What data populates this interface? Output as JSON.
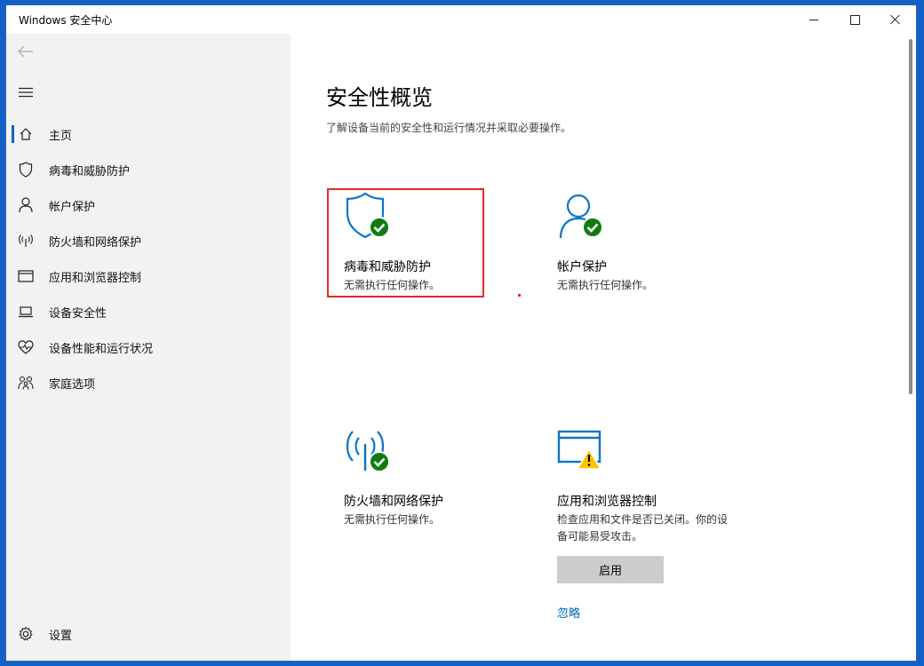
{
  "window": {
    "title": "Windows 安全中心"
  },
  "sidebar": {
    "items": [
      {
        "label": "主页",
        "icon": "home-icon",
        "selected": true
      },
      {
        "label": "病毒和威胁防护",
        "icon": "shield-icon"
      },
      {
        "label": "帐户保护",
        "icon": "person-icon"
      },
      {
        "label": "防火墙和网络保护",
        "icon": "wifi-antenna-icon"
      },
      {
        "label": "应用和浏览器控制",
        "icon": "app-window-icon"
      },
      {
        "label": "设备安全性",
        "icon": "laptop-icon"
      },
      {
        "label": "设备性能和运行状况",
        "icon": "heart-pulse-icon"
      },
      {
        "label": "家庭选项",
        "icon": "family-icon"
      }
    ],
    "settings_label": "设置"
  },
  "main": {
    "title": "安全性概览",
    "subtitle": "了解设备当前的安全性和运行情况并采取必要操作。",
    "cards": [
      {
        "title": "病毒和威胁防护",
        "status": "无需执行任何操作。",
        "icon": "shield-check-icon"
      },
      {
        "title": "帐户保护",
        "status": "无需执行任何操作。",
        "icon": "person-check-icon"
      },
      {
        "title": "防火墙和网络保护",
        "status": "无需执行任何操作。",
        "icon": "antenna-check-icon"
      },
      {
        "title": "应用和浏览器控制",
        "status": "检查应用和文件是否已关闭。你的设备可能易受攻击。",
        "icon": "window-warning-icon",
        "button": "启用",
        "link": "忽略"
      }
    ]
  },
  "colors": {
    "accent": "#0067b8",
    "icon_blue": "#0a74c9",
    "ok_green": "#107c10",
    "warning_yellow": "#ffc600",
    "highlight_red": "#e32b2b"
  }
}
